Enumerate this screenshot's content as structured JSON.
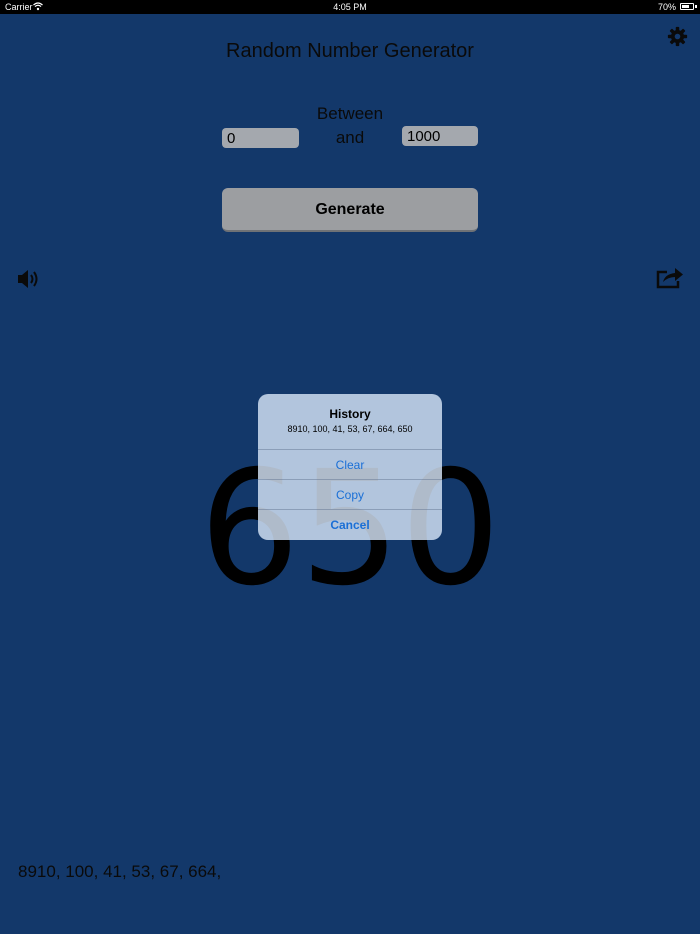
{
  "status": {
    "carrier": "Carrier",
    "time": "4:05 PM",
    "battery": "70%",
    "battery_level": 0.7
  },
  "app": {
    "title": "Random Number Generator"
  },
  "range": {
    "between_label": "Between",
    "and_label": "and",
    "min_value": "0",
    "max_value": "1000"
  },
  "generate_label": "Generate",
  "result": "650",
  "history_text": "8910, 100, 41, 53, 67, 664,",
  "alert": {
    "title": "History",
    "message": "8910, 100, 41, 53, 67, 664, 650",
    "buttons": {
      "clear": "Clear",
      "copy": "Copy",
      "cancel": "Cancel"
    }
  },
  "icons": {
    "settings": "gear-icon",
    "sound": "speaker-icon",
    "share": "share-icon",
    "wifi": "wifi-icon",
    "battery": "battery-icon"
  }
}
